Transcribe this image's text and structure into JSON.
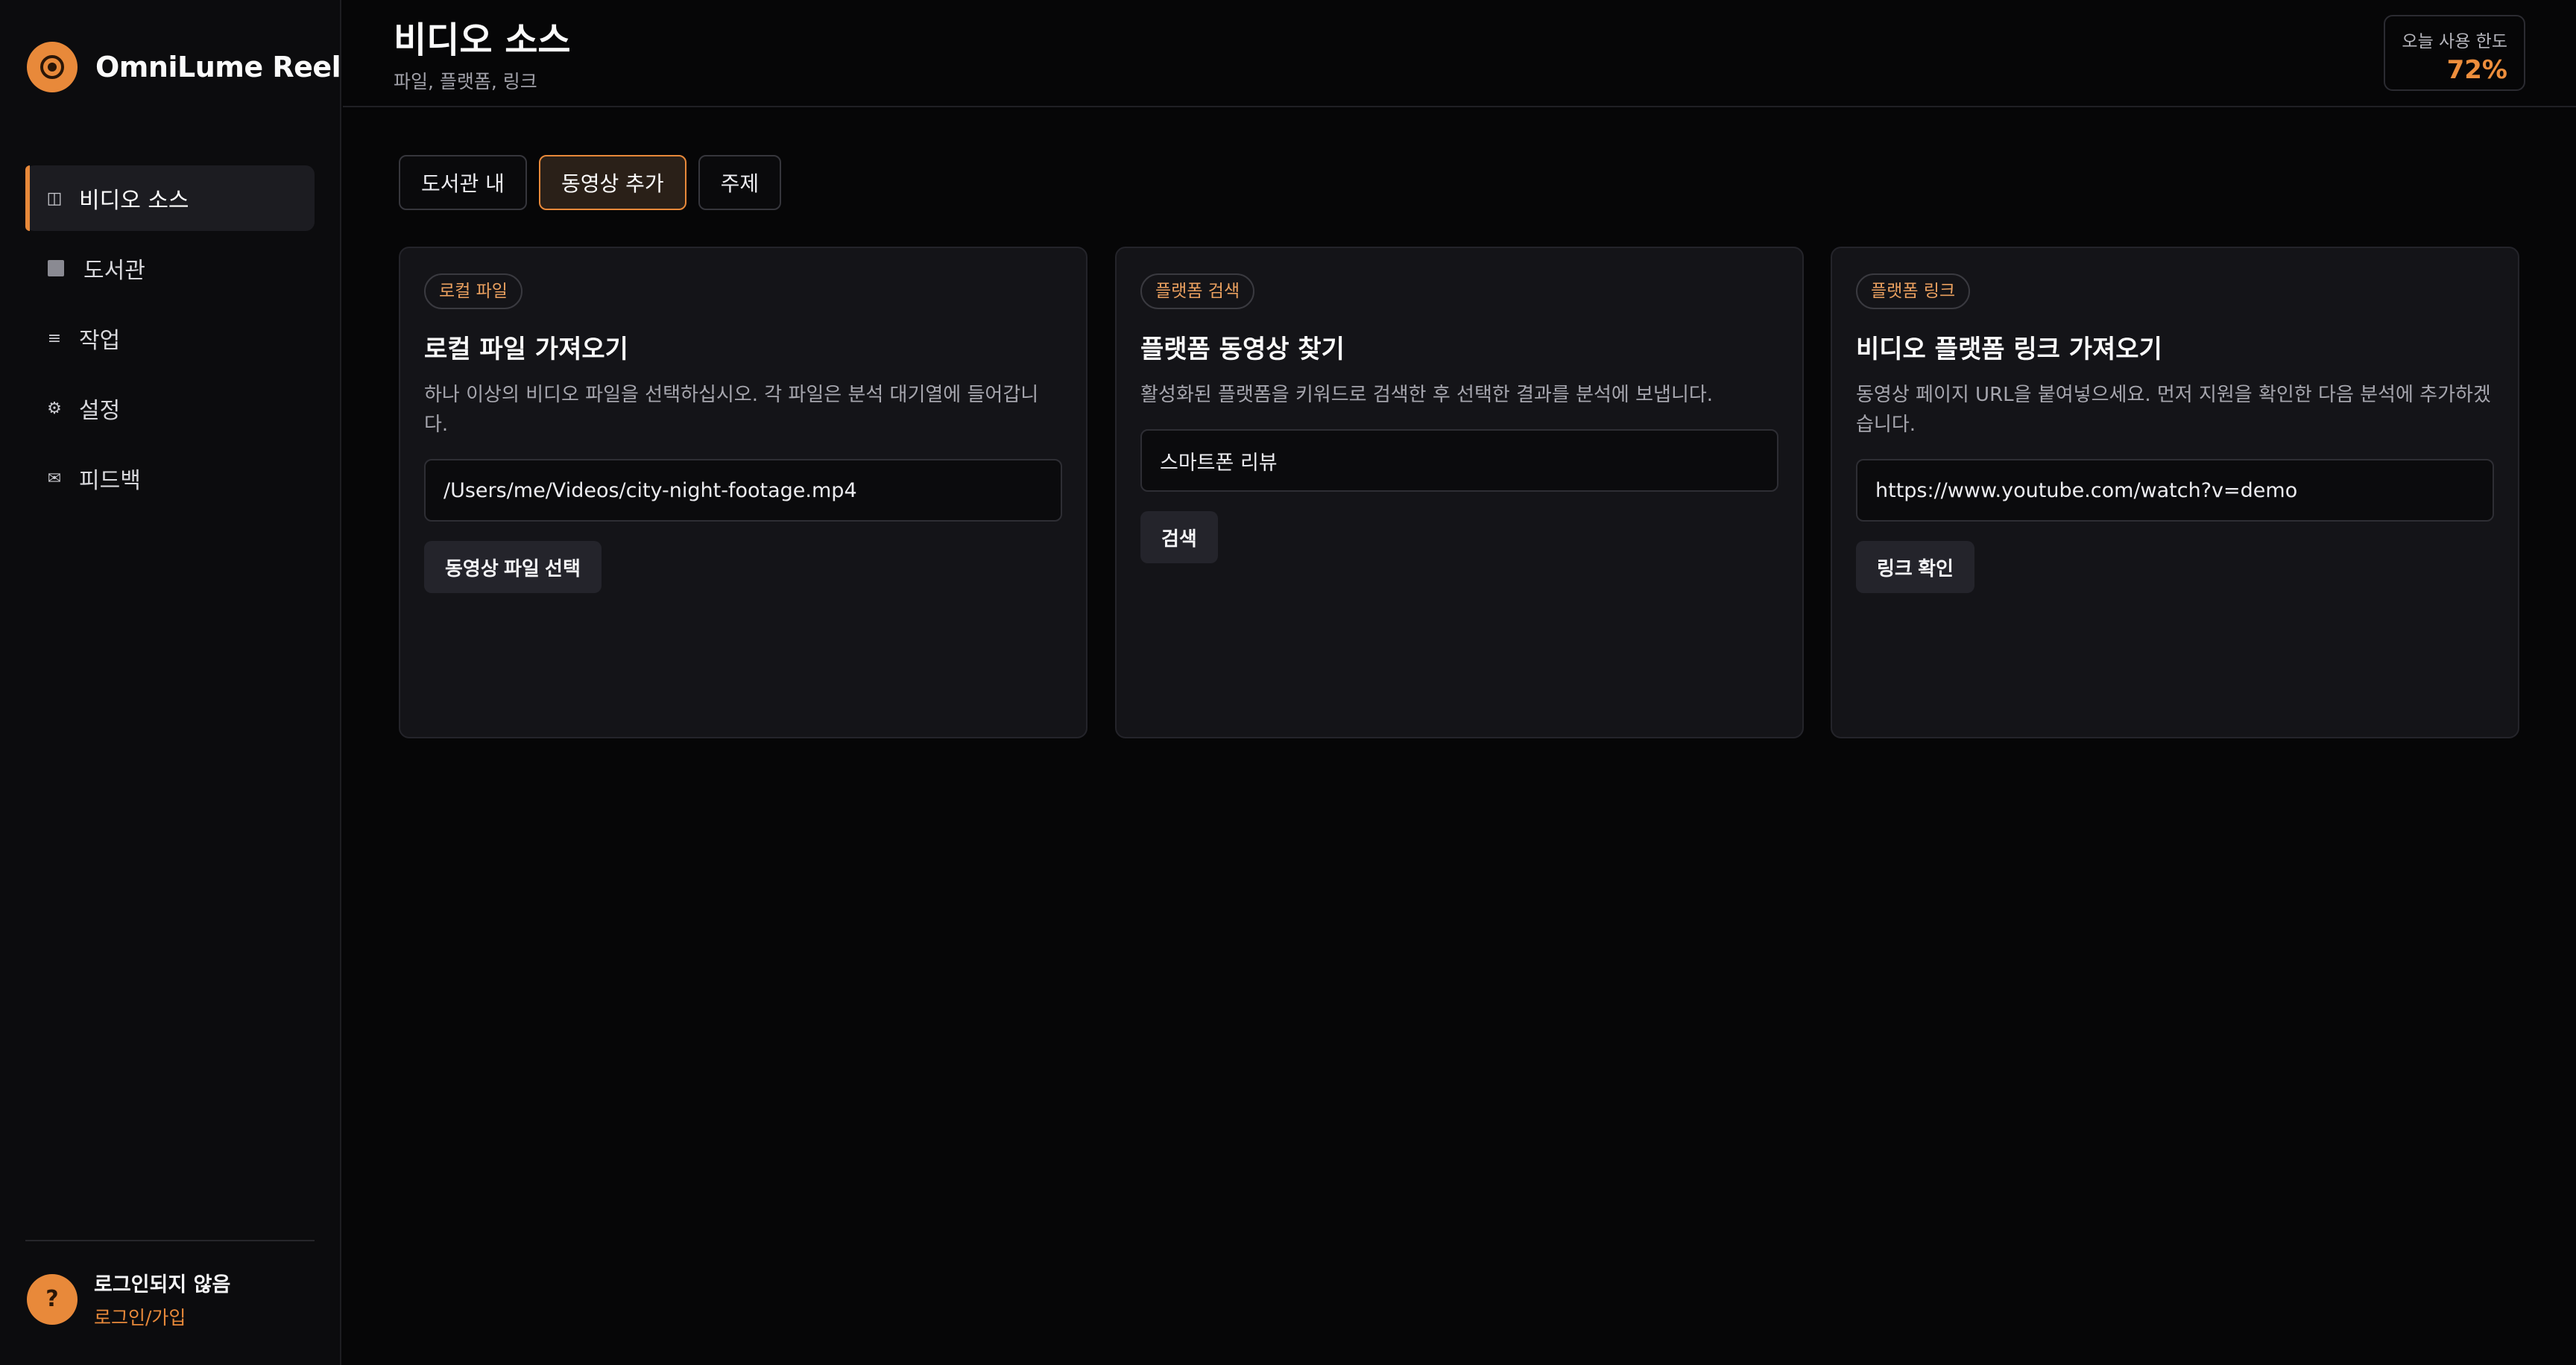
{
  "app": {
    "name": "OmniLume Reel"
  },
  "sidebar": {
    "items": [
      {
        "label": "비디오 소스",
        "icon": "columns-icon"
      },
      {
        "label": "도서관",
        "icon": "square-icon"
      },
      {
        "label": "작업",
        "icon": "list-icon"
      },
      {
        "label": "설정",
        "icon": "gear-icon"
      },
      {
        "label": "피드백",
        "icon": "mail-icon"
      }
    ],
    "active_index": 0
  },
  "user": {
    "avatar": "?",
    "status": "로그인되지 않음",
    "login_link": "로그인/가입"
  },
  "header": {
    "title": "비디오 소스",
    "subtitle": "파일, 플랫폼, 링크"
  },
  "quota": {
    "label": "오늘 사용 한도",
    "value": "72%"
  },
  "tabs": [
    {
      "label": "도서관 내"
    },
    {
      "label": "동영상 추가"
    },
    {
      "label": "주제"
    }
  ],
  "active_tab": 1,
  "cards": [
    {
      "badge": "로컬 파일",
      "title": "로컬 파일 가져오기",
      "description": "하나 이상의 비디오 파일을 선택하십시오. 각 파일은 분석 대기열에 들어갑니다.",
      "input_value": "/Users/me/Videos/city-night-footage.mp4",
      "button": "동영상 파일 선택"
    },
    {
      "badge": "플랫폼 검색",
      "title": "플랫폼 동영상 찾기",
      "description": "활성화된 플랫폼을 키워드로 검색한 후 선택한 결과를 분석에 보냅니다.",
      "input_value": "스마트폰 리뷰",
      "button": "검색"
    },
    {
      "badge": "플랫폼 링크",
      "title": "비디오 플랫폼 링크 가져오기",
      "description": "동영상 페이지 URL을 붙여넣으세요. 먼저 지원을 확인한 다음 분석에 추가하겠습니다.",
      "input_value": "https://www.youtube.com/watch?v=demo",
      "button": "링크 확인"
    }
  ],
  "colors": {
    "accent": "#e8893a",
    "background": "#060607",
    "card": "#141418"
  }
}
